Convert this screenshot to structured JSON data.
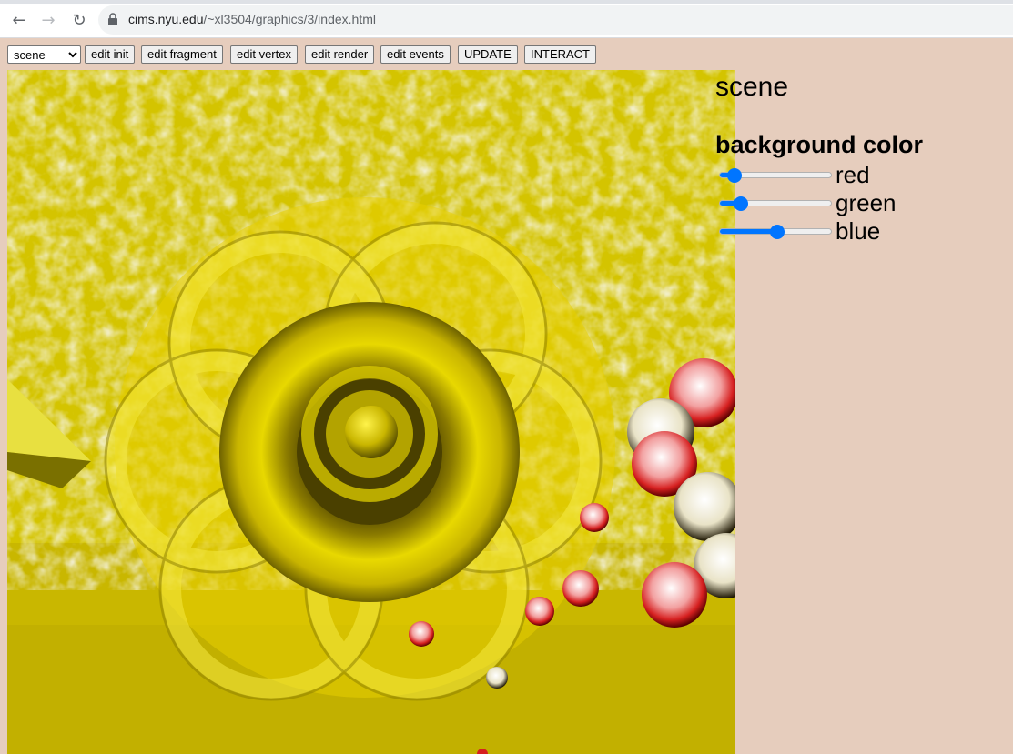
{
  "browser": {
    "url_host": "cims.nyu.edu",
    "url_path": "/~xl3504/graphics/3/index.html"
  },
  "toolbar": {
    "scene_select": {
      "selected": "scene"
    },
    "buttons": [
      {
        "label": "edit init"
      },
      {
        "label": "edit fragment"
      },
      {
        "label": "edit vertex"
      },
      {
        "label": "edit render"
      },
      {
        "label": "edit events"
      },
      {
        "label": "UPDATE"
      },
      {
        "label": "INTERACT"
      }
    ]
  },
  "panel": {
    "title": "scene",
    "heading": "background color",
    "sliders": [
      {
        "label": "red",
        "value": 0.08
      },
      {
        "label": "green",
        "value": 0.15
      },
      {
        "label": "blue",
        "value": 0.52
      }
    ]
  },
  "colors": {
    "page_background": "#e6cdbd",
    "canvas_yellow": "#c4b400",
    "accent": "#0075ff"
  }
}
